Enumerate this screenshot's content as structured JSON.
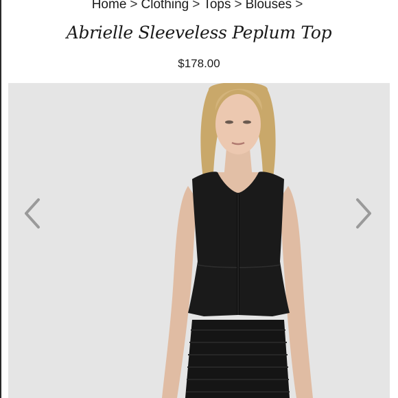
{
  "breadcrumb": {
    "items": [
      "Home",
      "Clothing",
      "Tops",
      "Blouses"
    ],
    "separator": ">"
  },
  "product": {
    "title": "Abrielle Sleeveless Peplum Top",
    "price": "$178.00"
  },
  "gallery": {
    "prev_icon": "chevron-left-icon",
    "next_icon": "chevron-right-icon",
    "arrow_color": "#9a9a9a",
    "background_color": "#e5e5e5"
  }
}
